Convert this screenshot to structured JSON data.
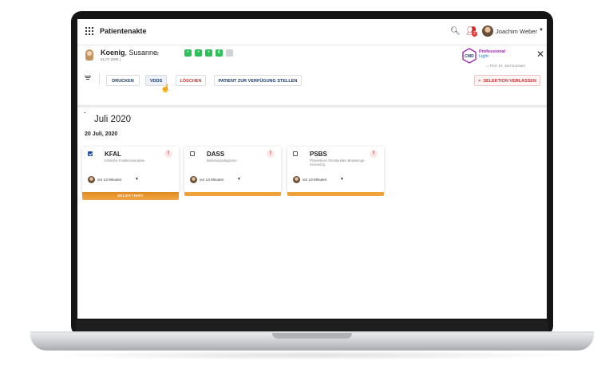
{
  "colors": {
    "accent": "#1f4fa3",
    "danger": "#d32f2f",
    "card_bar": "#f0a23a",
    "flag_green": "#2fbf5a"
  },
  "header": {
    "app_title": "Patientenakte",
    "icons": [
      "apps-grid-icon",
      "search-icon",
      "users-alert-icon",
      "chevron-down-icon"
    ],
    "users_badge": "2",
    "user_name": "Joachim Weber"
  },
  "patient": {
    "last_name": "Koenig",
    "first_name": ", Susanne",
    "dob": "31.07.2005 |",
    "gender_icon": "female-icon",
    "flags": [
      "•",
      "•",
      "•",
      "€",
      ""
    ]
  },
  "brand": {
    "logo_text": "CMD",
    "line1": "Professional",
    "line2": "Light",
    "sub": "→ Prof. Dr. Joel Gunsam"
  },
  "actions": {
    "print": "DRUCKEN",
    "vdds": "VDDS",
    "delete": "LÖSCHEN",
    "provide": "PATIENT ZUR VERFÜGUNG STELLEN",
    "exit_selection": "SELEKTION VERLASSEN",
    "exit_icon": "×"
  },
  "timeline": {
    "month": "Juli 2020",
    "date": "20 Juli, 2020"
  },
  "cards": [
    {
      "title": "KFAL",
      "subtitle": "Klinische Funktionsanalyse",
      "time": "vor 13 Minuten",
      "selected": true,
      "selected_label": "SELEKTIERT"
    },
    {
      "title": "DASS",
      "subtitle": "Belastungsdiagnose",
      "time": "vor 13 Minuten",
      "selected": false
    },
    {
      "title": "PSBS",
      "subtitle": "Präventives Strukturelles Belastungs-Screening",
      "time": "vor 13 Minuten",
      "selected": false
    }
  ],
  "close_symbol": "✕"
}
